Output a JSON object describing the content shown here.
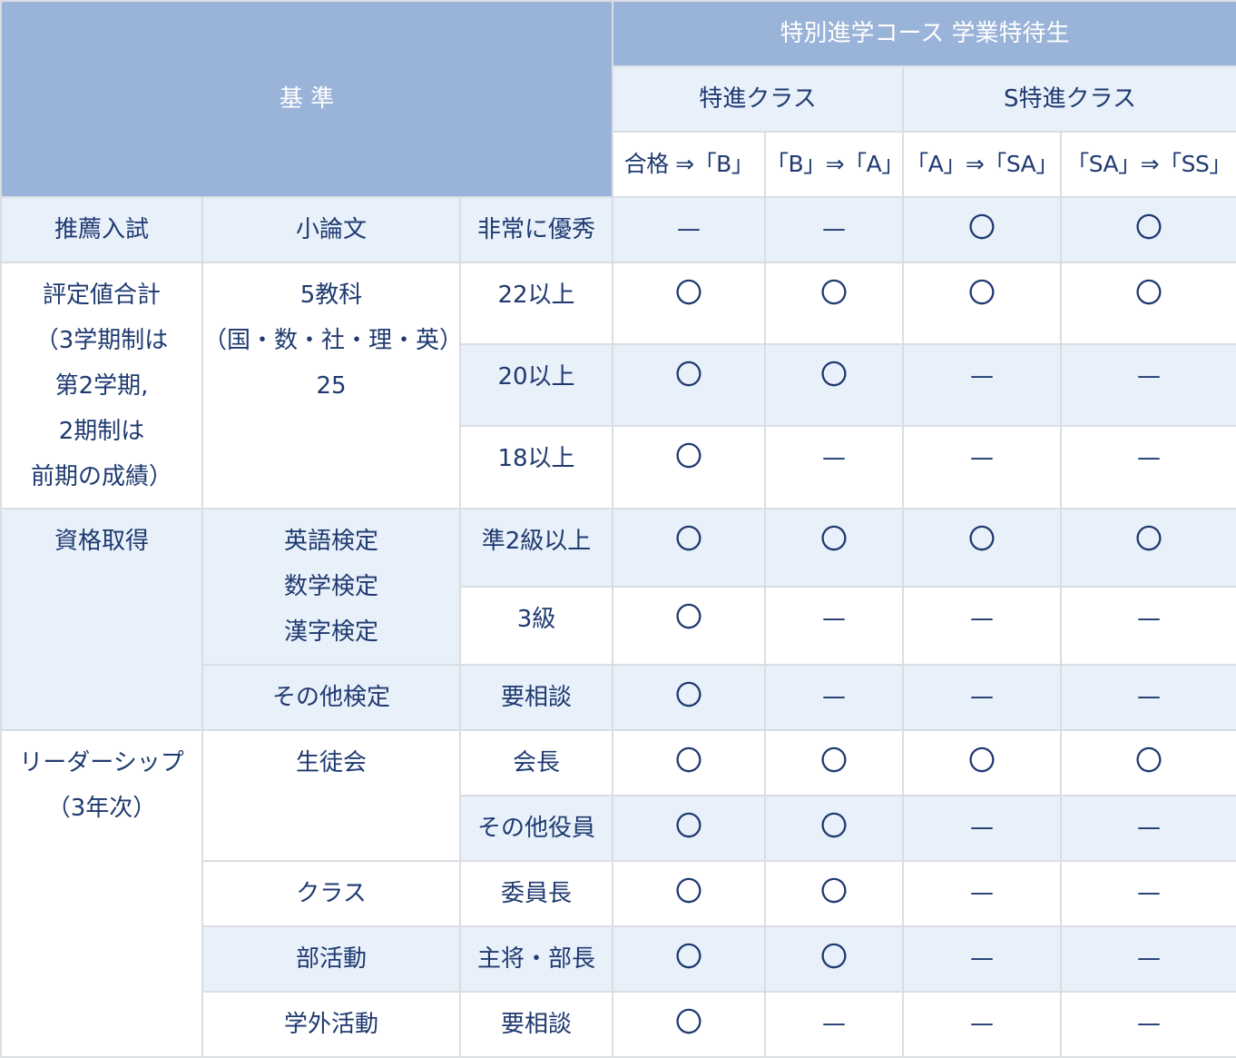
{
  "header": {
    "criteria": "基 準",
    "course": "特別進学コース 学業特待生",
    "class_tokushin": "特進クラス",
    "class_s_tokushin": "S特進クラス",
    "cols": [
      "合格 ⇒「B」",
      "「B」⇒「A」",
      "「A」⇒「SA」",
      "「SA」⇒「SS」"
    ]
  },
  "marks": {
    "circle": "〇",
    "dash": "—"
  },
  "rows": {
    "suisen": {
      "cat": "推薦入試",
      "sub": "小論文",
      "level": "非常に優秀",
      "marks": [
        "—",
        "—",
        "〇",
        "〇"
      ]
    },
    "hyotei": {
      "cat_lines": [
        "評定値合計",
        "（3学期制は",
        "第2学期,",
        "2期制は",
        "前期の成績）"
      ],
      "sub_lines": [
        "5教科",
        "（国・数・社・理・英）",
        "25"
      ],
      "items": [
        {
          "level": "22以上",
          "marks": [
            "〇",
            "〇",
            "〇",
            "〇"
          ]
        },
        {
          "level": "20以上",
          "marks": [
            "〇",
            "〇",
            "—",
            "—"
          ]
        },
        {
          "level": "18以上",
          "marks": [
            "〇",
            "—",
            "—",
            "—"
          ]
        }
      ]
    },
    "shikaku": {
      "cat": "資格取得",
      "sub_lines": [
        "英語検定",
        "数学検定",
        "漢字検定"
      ],
      "items": [
        {
          "level": "準2級以上",
          "marks": [
            "〇",
            "〇",
            "〇",
            "〇"
          ]
        },
        {
          "level": "3級",
          "marks": [
            "〇",
            "—",
            "—",
            "—"
          ]
        }
      ],
      "other": {
        "sub": "その他検定",
        "level": "要相談",
        "marks": [
          "〇",
          "—",
          "—",
          "—"
        ]
      }
    },
    "leader": {
      "cat_lines": [
        "リーダーシップ",
        "（3年次）"
      ],
      "seitokai": {
        "sub": "生徒会",
        "items": [
          {
            "level": "会長",
            "marks": [
              "〇",
              "〇",
              "〇",
              "〇"
            ]
          },
          {
            "level": "その他役員",
            "marks": [
              "〇",
              "〇",
              "—",
              "—"
            ]
          }
        ]
      },
      "class": {
        "sub": "クラス",
        "level": "委員長",
        "marks": [
          "〇",
          "〇",
          "—",
          "—"
        ]
      },
      "bukatsu": {
        "sub": "部活動",
        "level": "主将・部長",
        "marks": [
          "〇",
          "〇",
          "—",
          "—"
        ]
      },
      "gakugai": {
        "sub": "学外活動",
        "level": "要相談",
        "marks": [
          "〇",
          "—",
          "—",
          "—"
        ]
      }
    }
  }
}
